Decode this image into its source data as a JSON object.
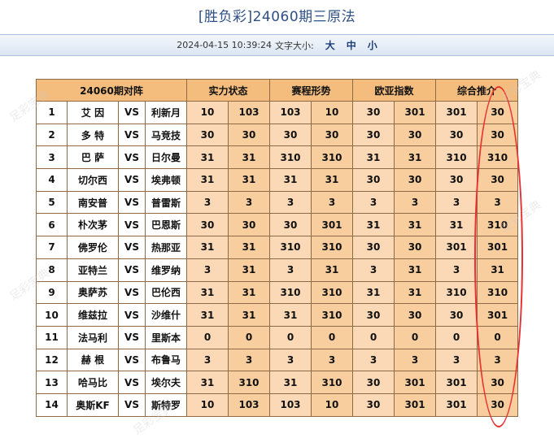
{
  "page": {
    "title": "[胜负彩]24060期三原法",
    "timestamp": "2024-04-15 10:39:24",
    "font_size_label": "文字大小:",
    "font_sizes": [
      "大",
      "中",
      "小"
    ],
    "watermark": "足彩宝典"
  },
  "table": {
    "header": [
      "24060期对阵",
      "实力状态",
      "赛程形势",
      "欧亚指数",
      "综合推介"
    ],
    "vs_label": "VS",
    "rows": [
      {
        "no": "1",
        "home": "艾 因",
        "away": "利新月",
        "v": [
          "10",
          "103",
          "103",
          "10",
          "30",
          "301",
          "301",
          "30"
        ]
      },
      {
        "no": "2",
        "home": "多 特",
        "away": "马竞技",
        "v": [
          "30",
          "30",
          "30",
          "30",
          "30",
          "30",
          "30",
          "30"
        ]
      },
      {
        "no": "3",
        "home": "巴 萨",
        "away": "日尔曼",
        "v": [
          "31",
          "31",
          "310",
          "310",
          "31",
          "31",
          "310",
          "310"
        ]
      },
      {
        "no": "4",
        "home": "切尔西",
        "away": "埃弗顿",
        "v": [
          "31",
          "31",
          "31",
          "31",
          "30",
          "30",
          "30",
          "30"
        ]
      },
      {
        "no": "5",
        "home": "南安普",
        "away": "普雷斯",
        "v": [
          "3",
          "3",
          "3",
          "3",
          "3",
          "3",
          "3",
          "3"
        ]
      },
      {
        "no": "6",
        "home": "朴次茅",
        "away": "巴恩斯",
        "v": [
          "30",
          "30",
          "30",
          "301",
          "31",
          "31",
          "31",
          "310"
        ]
      },
      {
        "no": "7",
        "home": "佛罗伦",
        "away": "热那亚",
        "v": [
          "31",
          "31",
          "310",
          "310",
          "30",
          "30",
          "301",
          "301"
        ]
      },
      {
        "no": "8",
        "home": "亚特兰",
        "away": "维罗纳",
        "v": [
          "3",
          "31",
          "3",
          "31",
          "3",
          "31",
          "3",
          "31"
        ]
      },
      {
        "no": "9",
        "home": "奥萨苏",
        "away": "巴伦西",
        "v": [
          "31",
          "31",
          "310",
          "310",
          "31",
          "31",
          "310",
          "310"
        ]
      },
      {
        "no": "10",
        "home": "维兹拉",
        "away": "沙维什",
        "v": [
          "31",
          "31",
          "31",
          "310",
          "30",
          "30",
          "30",
          "301"
        ]
      },
      {
        "no": "11",
        "home": "法马利",
        "away": "里斯本",
        "v": [
          "0",
          "0",
          "0",
          "0",
          "0",
          "0",
          "0",
          "0"
        ]
      },
      {
        "no": "12",
        "home": "赫 根",
        "away": "布鲁马",
        "v": [
          "3",
          "3",
          "3",
          "3",
          "3",
          "3",
          "3",
          "3"
        ]
      },
      {
        "no": "13",
        "home": "哈马比",
        "away": "埃尔夫",
        "v": [
          "31",
          "310",
          "31",
          "310",
          "30",
          "301",
          "301",
          "30"
        ]
      },
      {
        "no": "14",
        "home": "奥斯KF",
        "away": "斯特罗",
        "v": [
          "10",
          "103",
          "103",
          "10",
          "30",
          "301",
          "301",
          "30"
        ]
      }
    ]
  },
  "colors": {
    "header_bg": "#f4bd7e",
    "cell_bg": "#fbd9b6",
    "highlight": "#e8312f",
    "title": "#2e4f86"
  }
}
